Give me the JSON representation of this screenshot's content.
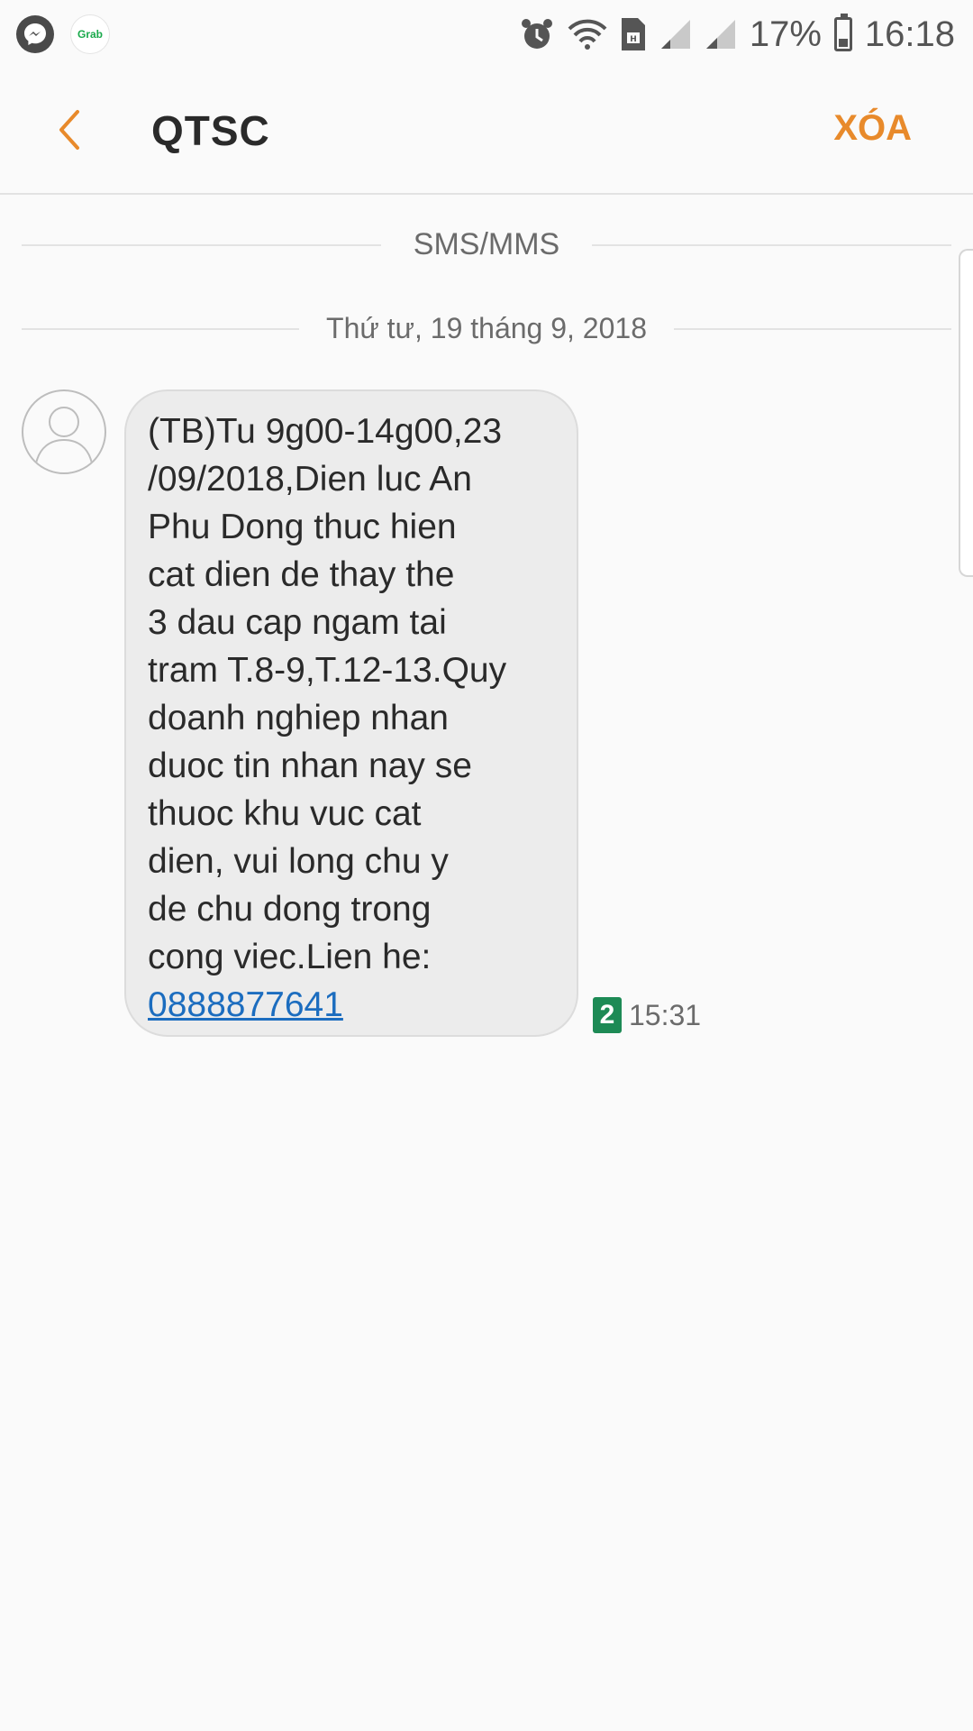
{
  "status_bar": {
    "battery_percent": "17%",
    "time": "16:18",
    "notifications": [
      "messenger-icon",
      "grab-icon"
    ],
    "grab_text": "Grab"
  },
  "header": {
    "title": "QTSC",
    "delete_label": "XÓA",
    "accent_color": "#e88a2b"
  },
  "thread": {
    "channel_label": "SMS/MMS",
    "date_label": "Thứ tư, 19 tháng 9, 2018"
  },
  "message": {
    "text": "(TB)Tu 9g00-14g00,23\n/09/2018,Dien luc An\nPhu Dong thuc hien\ncat dien de thay the\n3 dau cap ngam tai\ntram T.8-9,T.12-13.Quy\ndoanh nghiep nhan\nduoc tin nhan nay se\nthuoc khu vuc cat\ndien, vui long chu y\nde chu dong trong\ncong viec.Lien he:",
    "phone": "0888877641",
    "sim": "2",
    "time": "15:31"
  }
}
